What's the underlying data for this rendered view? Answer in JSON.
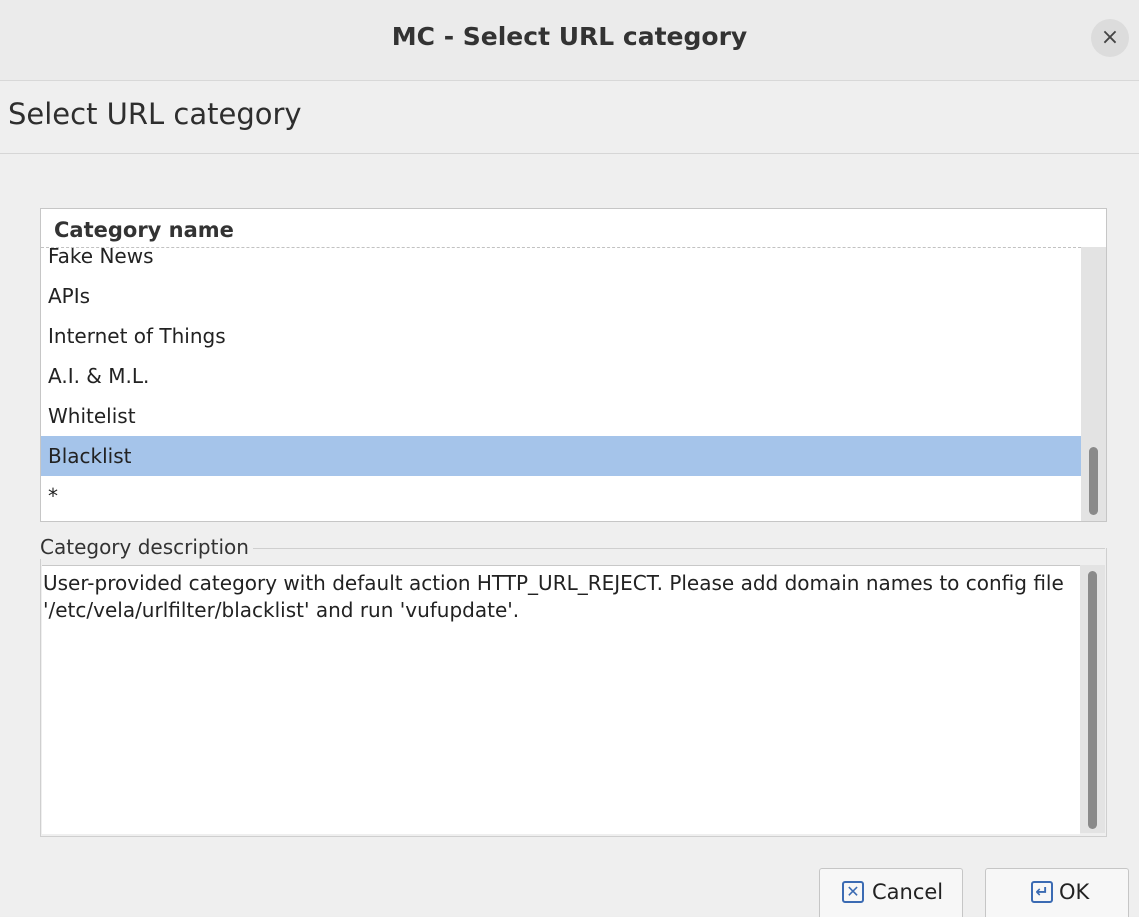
{
  "window": {
    "title": "MC - Select URL category",
    "close_glyph": "×"
  },
  "header": {
    "title": "Select URL category"
  },
  "category_list": {
    "column_header": "Category name",
    "rows": [
      {
        "label": "Fake News"
      },
      {
        "label": "APIs"
      },
      {
        "label": "Internet of Things"
      },
      {
        "label": "A.I. & M.L."
      },
      {
        "label": "Whitelist"
      },
      {
        "label": "Blacklist",
        "selected": true
      },
      {
        "label": "*"
      }
    ],
    "selected_color": "#a5c4ea"
  },
  "description": {
    "label": "Category description",
    "text": "User-provided category with default action HTTP_URL_REJECT. Please add domain names to config file '/etc/vela/urlfilter/blacklist' and run 'vufupdate'."
  },
  "buttons": {
    "cancel_label": "Cancel",
    "cancel_icon": "cancel-icon",
    "cancel_glyph": "✕",
    "ok_label": "OK",
    "ok_icon": "enter-icon",
    "ok_glyph": "↵"
  },
  "colors": {
    "accent": "#3b6bb3"
  }
}
